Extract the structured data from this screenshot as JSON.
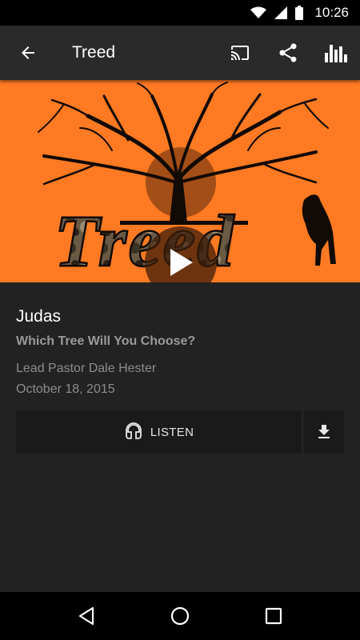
{
  "status_bar": {
    "time": "10:26"
  },
  "app_bar": {
    "title": "Treed"
  },
  "hero": {
    "logo_text": "Treed",
    "background_color": "#ff7a22"
  },
  "sermon": {
    "title": "Judas",
    "series": "Which Tree Will You Choose?",
    "speaker": "Lead Pastor Dale Hester",
    "date": "October 18, 2015"
  },
  "actions": {
    "listen_label": "LISTEN"
  },
  "icons": {
    "back": "arrow-back-icon",
    "cast": "cast-icon",
    "share": "share-icon",
    "stats": "bar-chart-icon",
    "play": "play-icon",
    "headphones": "headphones-icon",
    "download": "download-icon"
  }
}
